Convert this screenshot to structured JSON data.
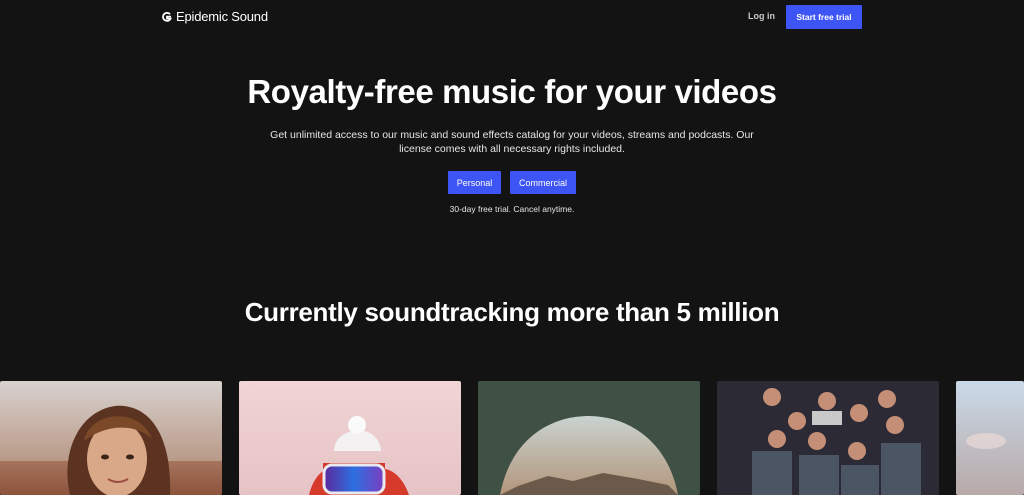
{
  "header": {
    "brand": "Epidemic Sound",
    "login_label": "Log in",
    "trial_label": "Start free trial"
  },
  "hero": {
    "title": "Royalty-free music for your videos",
    "subtitle": "Get unlimited access to our music and sound effects catalog for your videos, streams and podcasts. Our license comes with all necessary rights included.",
    "buttons": [
      {
        "label": "Personal"
      },
      {
        "label": "Commercial"
      }
    ],
    "note": "30-day free trial. Cancel anytime."
  },
  "showcase": {
    "title": "Currently soundtracking more than 5 million"
  },
  "colors": {
    "background": "#131313",
    "accent": "#3d55f5"
  }
}
